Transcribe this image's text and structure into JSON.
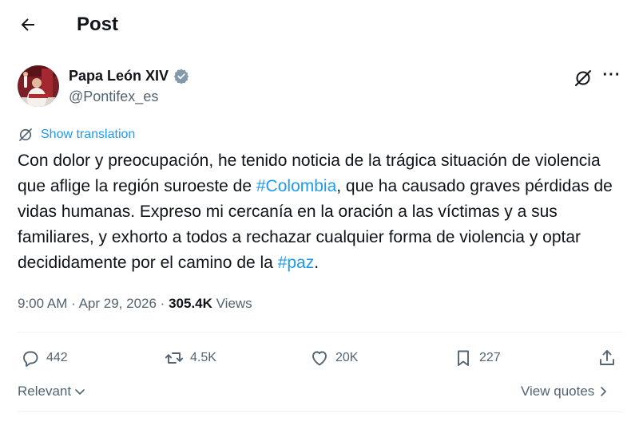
{
  "header": {
    "title": "Post"
  },
  "author": {
    "name": "Papa León XIV",
    "handle": "@Pontifex_es"
  },
  "translate": {
    "label": "Show translation"
  },
  "tweet": {
    "segments": [
      {
        "text": "Con dolor y preocupación, he tenido noticia de la trágica situación de violencia que aflige la región suroeste de ",
        "hashtag": false
      },
      {
        "text": "#Colombia",
        "hashtag": true
      },
      {
        "text": ", que ha causado graves pérdidas de vidas humanas. Expreso mi cercanía en la oración a las víctimas y a sus familiares, y exhorto a todos a rechazar cualquier forma de violencia y optar decididamente por el camino de la ",
        "hashtag": false
      },
      {
        "text": "#paz",
        "hashtag": true
      },
      {
        "text": ".",
        "hashtag": false
      }
    ]
  },
  "meta": {
    "time": "9:00 AM",
    "separator": "·",
    "date": "Apr 29, 2026",
    "views_count": "305.4K",
    "views_label": "Views"
  },
  "actions": {
    "replies": "442",
    "reposts": "4.5K",
    "likes": "20K",
    "bookmarks": "227"
  },
  "footer": {
    "sort_label": "Relevant",
    "quotes_label": "View quotes"
  },
  "colors": {
    "accent": "#1d9bf0",
    "verified": "#829aab",
    "text": "#0f1419",
    "secondary": "#536471"
  }
}
